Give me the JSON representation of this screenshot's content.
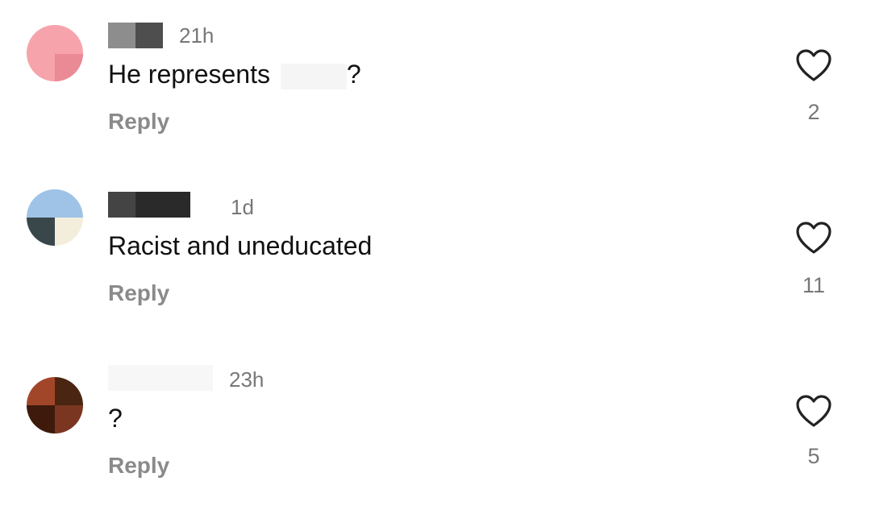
{
  "comments": [
    {
      "timestamp": "21h",
      "text_before": "He represents",
      "text_after": "?",
      "reply_label": "Reply",
      "like_count": "2"
    },
    {
      "timestamp": "1d",
      "text": "Racist and uneducated",
      "reply_label": "Reply",
      "like_count": "11"
    },
    {
      "timestamp": "23h",
      "text": "?",
      "reply_label": "Reply",
      "like_count": "5"
    }
  ],
  "colors": {
    "text": "#111111",
    "secondary": "#777777",
    "reply": "#8a8a8a",
    "heart_stroke": "#222222"
  },
  "icons": {
    "like": "heart-outline-icon"
  }
}
